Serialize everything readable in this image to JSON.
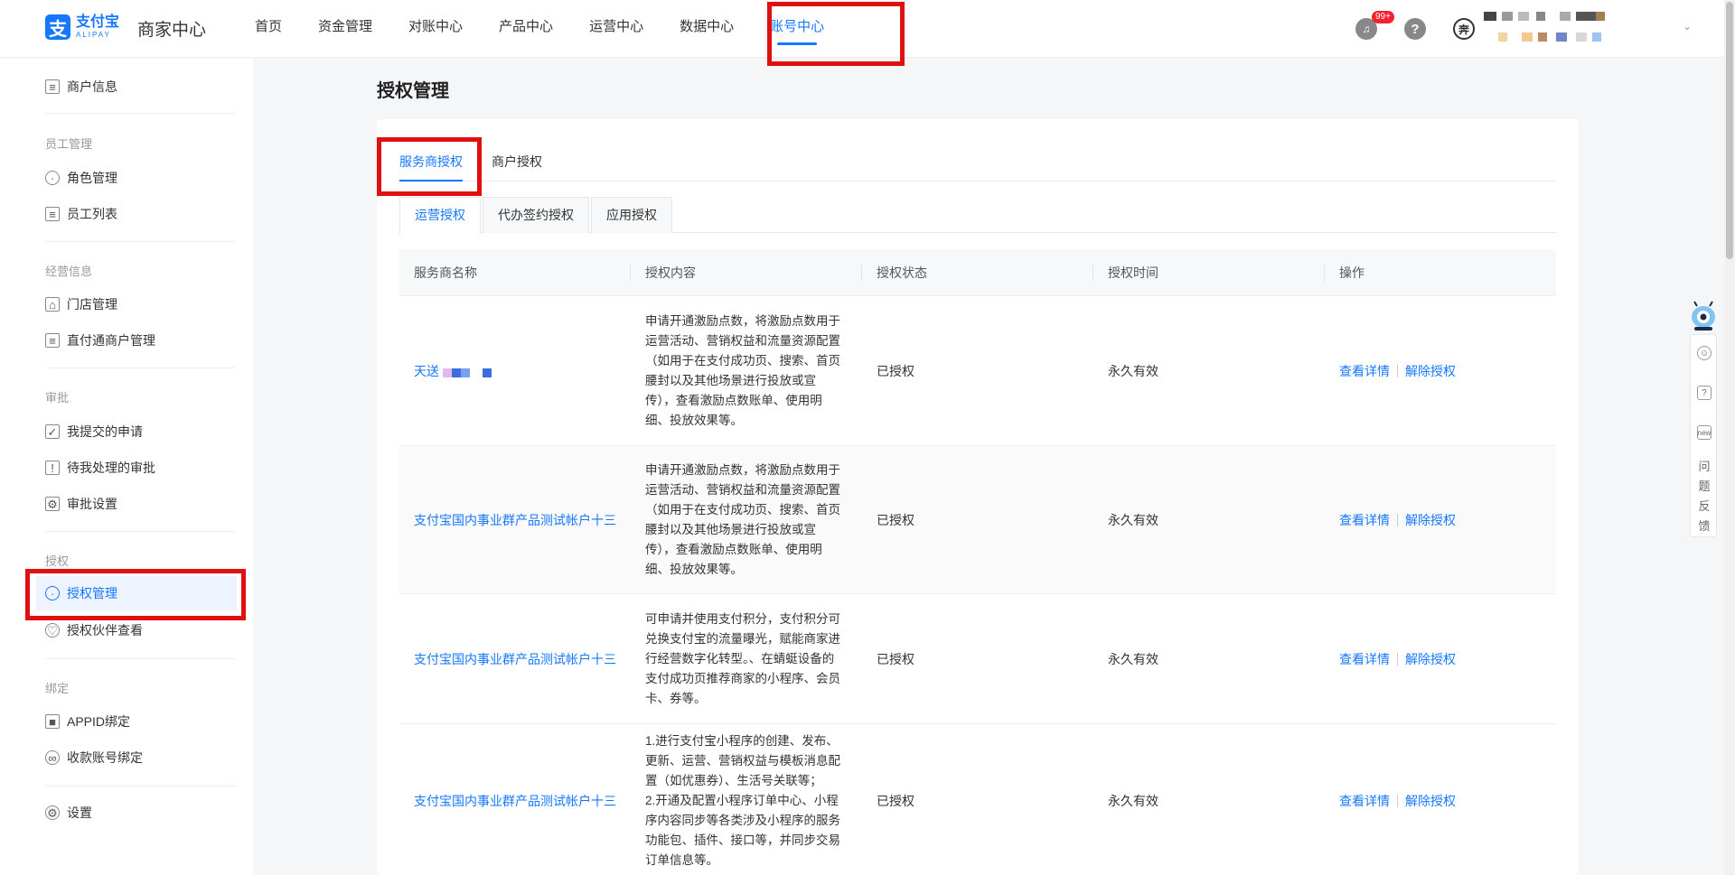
{
  "brand": {
    "logo_cn": "支付宝",
    "logo_en": "ALIPAY",
    "app_title": "商家中心",
    "accent": "#1677ff"
  },
  "nav": {
    "items": [
      "首页",
      "资金管理",
      "对账中心",
      "产品中心",
      "运营中心",
      "数据中心",
      "账号中心"
    ],
    "active": "账号中心"
  },
  "header": {
    "badge": "99+",
    "avatar_char": "奔"
  },
  "sidebar": {
    "merchant_info": "商户信息",
    "group_staff": "员工管理",
    "role_mgmt": "角色管理",
    "staff_list": "员工列表",
    "group_ops": "经营信息",
    "store_mgmt": "门店管理",
    "zhiying": "直付通商户管理",
    "group_approval": "审批",
    "my_submitted": "我提交的申请",
    "pending_approval": "待我处理的审批",
    "approval_settings": "审批设置",
    "group_auth": "授权",
    "auth_mgmt": "授权管理",
    "auth_partner": "授权伙伴查看",
    "group_bind": "绑定",
    "appid_bind": "APPID绑定",
    "account_bind": "收款账号绑定",
    "settings": "设置"
  },
  "page": {
    "title": "授权管理",
    "tabs": [
      "服务商授权",
      "商户授权"
    ],
    "subtabs": [
      "运营授权",
      "代办签约授权",
      "应用授权"
    ]
  },
  "table": {
    "headers": [
      "服务商名称",
      "授权内容",
      "授权状态",
      "授权时间",
      "操作"
    ],
    "ops": {
      "view": "查看详情",
      "revoke": "解除授权"
    },
    "rows": [
      {
        "name": "天送",
        "content": [
          "申请开通激励点数，将激励点数用于",
          "运营活动、营销权益和流量资源配置",
          "（如用于在支付成功页、搜索、首页",
          "腰封以及其他场景进行投放或宣",
          "传），查看激励点数账单、使用明",
          "细、投放效果等。"
        ],
        "status": "已授权",
        "time": "永久有效"
      },
      {
        "name": "支付宝国内事业群产品测试帐户十三",
        "content": [
          "申请开通激励点数，将激励点数用于",
          "运营活动、营销权益和流量资源配置",
          "（如用于在支付成功页、搜索、首页",
          "腰封以及其他场景进行投放或宣",
          "传），查看激励点数账单、使用明",
          "细、投放效果等。"
        ],
        "status": "已授权",
        "time": "永久有效"
      },
      {
        "name": "支付宝国内事业群产品测试帐户十三",
        "content": [
          "可申请并使用支付积分，支付积分可",
          "兑换支付宝的流量曝光，赋能商家进",
          "行经营数字化转型。、在蜻蜓设备的",
          "支付成功页推荐商家的小程序、会员",
          "卡、券等。"
        ],
        "status": "已授权",
        "time": "永久有效"
      },
      {
        "name": "支付宝国内事业群产品测试帐户十三",
        "content": [
          "1.进行支付宝小程序的创建、发布、",
          "更新、运营、营销权益与模板消息配",
          "置（如优惠券）、生活号关联等；",
          "2.开通及配置小程序订单中心、小程",
          "序内容同步等各类涉及小程序的服务",
          "功能包、插件、接口等，并同步交易",
          "订单信息等。"
        ],
        "status": "已授权",
        "time": "永久有效"
      }
    ]
  },
  "float": {
    "feedback": [
      "问",
      "题",
      "反",
      "馈"
    ],
    "new_label": "new"
  }
}
